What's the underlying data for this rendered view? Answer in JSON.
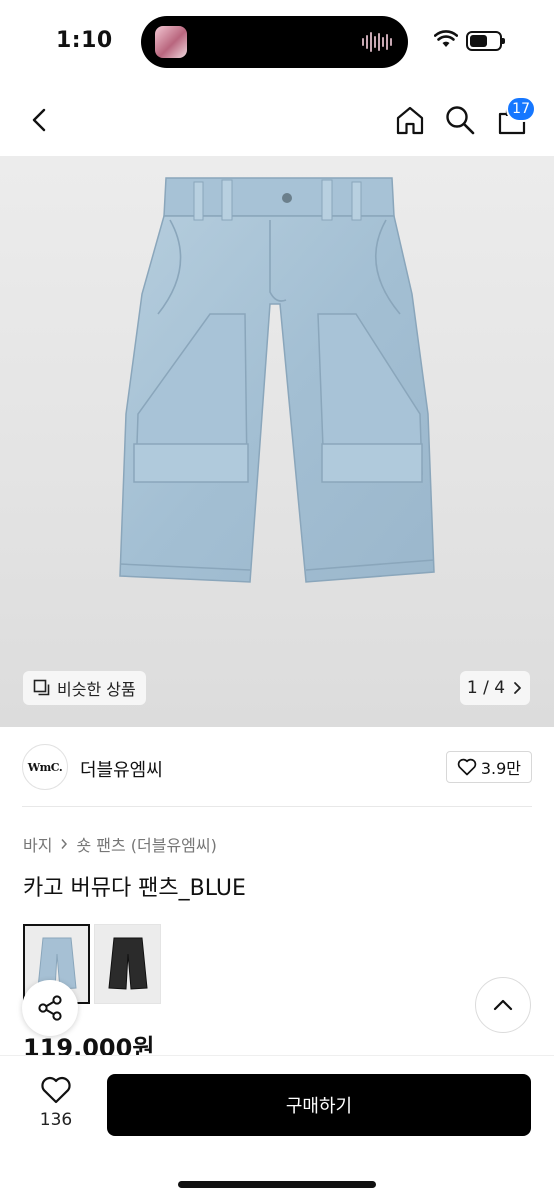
{
  "status_bar": {
    "time": "1:10",
    "battery_level": 0.6
  },
  "nav": {
    "cart_count": "17",
    "icons": [
      "back-arrow-icon",
      "home-icon",
      "search-icon",
      "shopping-bag-icon"
    ]
  },
  "hero": {
    "similar_label": "비슷한 상품",
    "pager": "1 / 4",
    "colors": {
      "denim": "#a9c3d6",
      "denim_dark": "#8eabc1",
      "background": "#e6e6e6"
    }
  },
  "brand": {
    "logo_text": "WmC.",
    "name": "더블유엠씨",
    "likes": "3.9만"
  },
  "product": {
    "breadcrumb": [
      "바지",
      "숏 팬츠 (더블유엠씨)"
    ],
    "title": "카고 버뮤다 팬츠_BLUE",
    "price": "119,000원",
    "variants": [
      "BLUE",
      "BLACK"
    ]
  },
  "bottom": {
    "wish_count": "136",
    "buy_label": "구매하기",
    "accent": "#1677ff"
  }
}
